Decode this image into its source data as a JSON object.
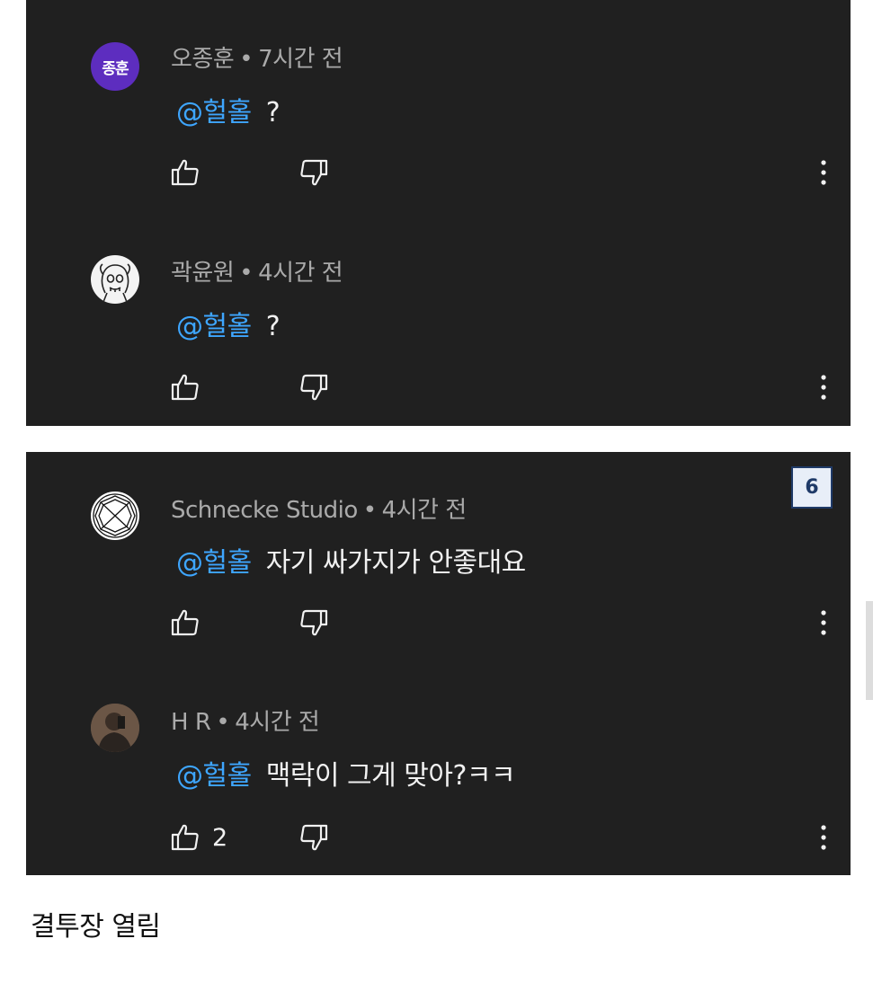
{
  "panels": [
    {
      "comments": [
        {
          "avatar_text": "종훈",
          "author": "오종훈",
          "time": "7시간 전",
          "mention": "@헐홀",
          "text": "?",
          "likes": ""
        },
        {
          "avatar_text": "",
          "author": "곽윤원",
          "time": "4시간 전",
          "mention": "@헐홀",
          "text": "?",
          "likes": ""
        }
      ]
    },
    {
      "comments": [
        {
          "avatar_text": "",
          "author": "Schnecke Studio",
          "time": "4시간 전",
          "mention": "@헐홀",
          "text": "자기 싸가지가 안좋대요",
          "likes": ""
        },
        {
          "avatar_text": "",
          "author": "H R",
          "time": "4시간 전",
          "mention": "@헐홀",
          "text": "맥락이 그게 맞아?ㅋㅋ",
          "likes": "2"
        }
      ]
    }
  ],
  "separator": "•",
  "badge": "6",
  "caption": "결투장 열림",
  "colors": {
    "panel_bg": "#202020",
    "mention": "#3ea6ff",
    "meta": "#aaaaaa",
    "avatar_purple": "#5d2dbf"
  },
  "icons": [
    "thumb-up-icon",
    "thumb-down-icon",
    "more-vertical-icon"
  ]
}
